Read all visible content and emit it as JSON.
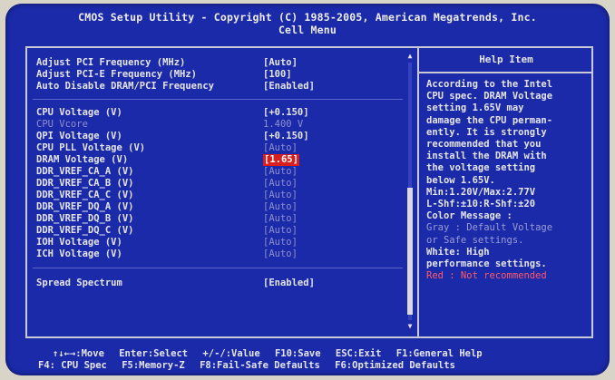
{
  "header": {
    "title_line1": "CMOS Setup Utility - Copyright (C) 1985-2005, American Megatrends, Inc.",
    "title_line2": "Cell Menu"
  },
  "settings": {
    "r1": {
      "label": "Adjust PCI Frequency (MHz)",
      "value": "[Auto]"
    },
    "r2": {
      "label": "Adjust PCI-E Frequency (MHz)",
      "value": "[100]"
    },
    "r3": {
      "label": "Auto Disable DRAM/PCI Frequency",
      "value": "[Enabled]"
    },
    "r4": {
      "label": "CPU Voltage (V)",
      "value": "[+0.150]"
    },
    "r5": {
      "label": "CPU Vcore",
      "value": "1.400 V"
    },
    "r6": {
      "label": "QPI Voltage (V)",
      "value": "[+0.150]"
    },
    "r7": {
      "label": "CPU PLL Voltage (V)",
      "value": "[Auto]"
    },
    "r8": {
      "label": "DRAM Voltage (V)",
      "value": "[1.65]"
    },
    "r9": {
      "label": "DDR_VREF_CA_A (V)",
      "value": "[Auto]"
    },
    "r10": {
      "label": "DDR_VREF_CA_B (V)",
      "value": "[Auto]"
    },
    "r11": {
      "label": "DDR_VREF_CA_C (V)",
      "value": "[Auto]"
    },
    "r12": {
      "label": "DDR_VREF_DQ_A (V)",
      "value": "[Auto]"
    },
    "r13": {
      "label": "DDR_VREF_DQ_B (V)",
      "value": "[Auto]"
    },
    "r14": {
      "label": "DDR_VREF_DQ_C (V)",
      "value": "[Auto]"
    },
    "r15": {
      "label": "IOH Voltage (V)",
      "value": "[Auto]"
    },
    "r16": {
      "label": "ICH Voltage (V)",
      "value": "[Auto]"
    },
    "r17": {
      "label": "Spread Spectrum",
      "value": "[Enabled]"
    }
  },
  "help": {
    "title": "Help Item",
    "l1": "According to the Intel",
    "l2": "CPU spec. DRAM Voltage",
    "l3": "setting 1.65V may",
    "l4": "damage the CPU perman-",
    "l5": "ently. It is strongly",
    "l6": "recommended that you",
    "l7": "install the DRAM with",
    "l8": "the voltage setting",
    "l9": "below 1.65V.",
    "l10": "Min:1.20V/Max:2.77V",
    "l11": "L-Shf:±10:R-Shf:±20",
    "l12": "Color Message :",
    "l13": "Gray : Default Voltage",
    "l14": "or Safe settings.",
    "l15": "White: High",
    "l16": "performance settings.",
    "l17": "Red : Not recommended"
  },
  "footer": {
    "move": "↑↓←→:Move",
    "select": "Enter:Select",
    "value": "+/-/:Value",
    "save": "F10:Save",
    "exit": "ESC:Exit",
    "help": "F1:General Help",
    "cpu_spec": "F4: CPU Spec",
    "memory": "F5:Memory-Z",
    "failsafe": "F8:Fail-Safe Defaults",
    "optimized": "F6:Optimized Defaults"
  },
  "colors": {
    "background": "#1b2aa8",
    "text": "#e4e4ee",
    "disabled": "#8c8fd0",
    "selected": "#d81e1e",
    "warning": "#ff5a6a"
  },
  "scrollbar": {
    "up_icon": "▲",
    "down_icon": "▼"
  }
}
